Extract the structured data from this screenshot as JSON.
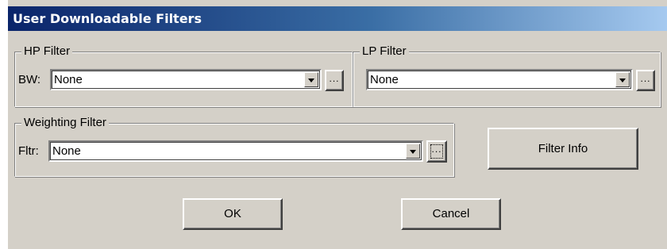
{
  "window": {
    "title": "User Downloadable Filters"
  },
  "hp_filter": {
    "legend": "HP Filter",
    "field_label": "BW:",
    "selected": "None",
    "browse_label": "..."
  },
  "lp_filter": {
    "legend": "LP Filter",
    "selected": "None",
    "browse_label": "..."
  },
  "weighting_filter": {
    "legend": "Weighting Filter",
    "field_label": "Fltr:",
    "selected": "None",
    "browse_label": "..."
  },
  "buttons": {
    "filter_info": "Filter Info",
    "ok": "OK",
    "cancel": "Cancel"
  },
  "icons": [
    "dropdown-arrow-icon"
  ]
}
